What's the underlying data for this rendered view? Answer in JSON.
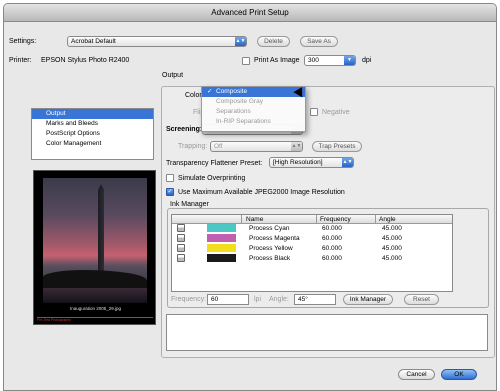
{
  "window": {
    "title": "Advanced Print Setup"
  },
  "settings": {
    "label": "Settings:",
    "value": "Acrobat Default",
    "delete_label": "Delete",
    "save_as_label": "Save As"
  },
  "printer": {
    "label": "Printer:",
    "value": "EPSON Stylus Photo R2400",
    "print_as_image_label": "Print As Image",
    "dpi_value": "300",
    "dpi_unit": "dpi"
  },
  "categories": {
    "items": [
      {
        "label": "Output"
      },
      {
        "label": "Marks and Bleeds"
      },
      {
        "label": "PostScript Options"
      },
      {
        "label": "Color Management"
      }
    ]
  },
  "preview": {
    "caption": "Inauguration 2005_29.jpg",
    "footer": "Pre-Test Photography"
  },
  "output": {
    "section_title": "Output",
    "color_label": "Color:",
    "flip_label": "Flip:",
    "negative_label": "Negative",
    "screening_label": "Screening:",
    "trapping_label": "Trapping:",
    "trapping_value": "Off",
    "trap_presets_label": "Trap Presets",
    "flattener_label": "Transparency Flattener Preset:",
    "flattener_value": "[High Resolution]",
    "simulate_overprinting_label": "Simulate Overprinting",
    "jpeg2000_label": "Use Maximum Available JPEG2000 Image Resolution"
  },
  "color_menu": {
    "options": [
      "Composite",
      "Composite Gray",
      "Separations",
      "In-RIP Separations"
    ],
    "selected": "Composite",
    "check": "✓"
  },
  "ink_manager": {
    "title": "Ink Manager",
    "columns": [
      "Name",
      "Frequency",
      "Angle"
    ],
    "inks": [
      {
        "name": "Process Cyan",
        "frequency": "60.000",
        "angle": "45.000",
        "color": "#4cc7c4"
      },
      {
        "name": "Process Magenta",
        "frequency": "60.000",
        "angle": "45.000",
        "color": "#c05fb2"
      },
      {
        "name": "Process Yellow",
        "frequency": "60.000",
        "angle": "45.000",
        "color": "#f4dc1e"
      },
      {
        "name": "Process Black",
        "frequency": "60.000",
        "angle": "45.000",
        "color": "#1a1a1a"
      }
    ],
    "frequency_label": "Frequency:",
    "frequency_value": "60",
    "frequency_unit": "lpi",
    "angle_label": "Angle:",
    "angle_value": "45°",
    "ink_manager_button": "Ink Manager",
    "reset_button": "Reset"
  },
  "footer": {
    "cancel_label": "Cancel",
    "ok_label": "OK"
  },
  "colors": {
    "accent": "#3875d7"
  }
}
